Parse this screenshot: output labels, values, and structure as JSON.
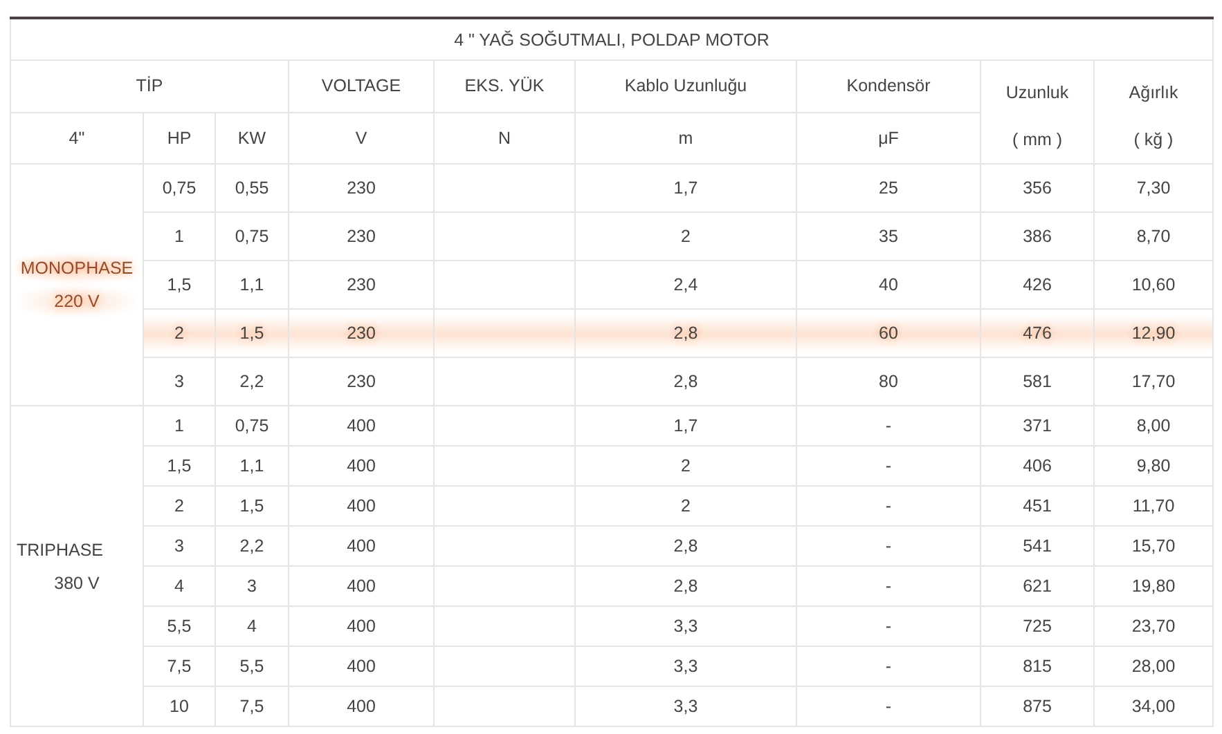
{
  "table": {
    "title": "4 \" YAĞ SOĞUTMALI, POLDAP MOTOR",
    "header_top": [
      {
        "label": "TİP"
      },
      {
        "label": "VOLTAGE"
      },
      {
        "label": "EKS. YÜK"
      },
      {
        "label": "Kablo Uzunluğu"
      },
      {
        "label": "Kondensör"
      }
    ],
    "header_units": [
      "4\"",
      "HP",
      "KW",
      "V",
      "N",
      "m",
      "μF"
    ],
    "header_tall": [
      {
        "label": "Uzunluk",
        "unit": "( mm )"
      },
      {
        "label": "Ağırlık",
        "unit": "( kğ )"
      }
    ],
    "groups": [
      {
        "label_lines": [
          "MONOPHASE",
          "220 V"
        ],
        "highlighted": true,
        "rows": [
          {
            "hp": "0,75",
            "kw": "0,55",
            "voltage": "230",
            "kablo": "1,7",
            "kondensor": "25",
            "uzunluk": "356",
            "agirlik": "7,30",
            "highlighted": false
          },
          {
            "hp": "1",
            "kw": "0,75",
            "voltage": "230",
            "kablo": "2",
            "kondensor": "35",
            "uzunluk": "386",
            "agirlik": "8,70",
            "highlighted": false
          },
          {
            "hp": "1,5",
            "kw": "1,1",
            "voltage": "230",
            "kablo": "2,4",
            "kondensor": "40",
            "uzunluk": "426",
            "agirlik": "10,60",
            "highlighted": false
          },
          {
            "hp": "2",
            "kw": "1,5",
            "voltage": "230",
            "kablo": "2,8",
            "kondensor": "60",
            "uzunluk": "476",
            "agirlik": "12,90",
            "highlighted": true
          },
          {
            "hp": "3",
            "kw": "2,2",
            "voltage": "230",
            "kablo": "2,8",
            "kondensor": "80",
            "uzunluk": "581",
            "agirlik": "17,70",
            "highlighted": false
          }
        ]
      },
      {
        "label_lines": [
          "TRIPHASE",
          "380 V"
        ],
        "highlighted": false,
        "rows": [
          {
            "hp": "1",
            "kw": "0,75",
            "voltage": "400",
            "kablo": "1,7",
            "kondensor": "-",
            "uzunluk": "371",
            "agirlik": "8,00",
            "highlighted": false
          },
          {
            "hp": "1,5",
            "kw": "1,1",
            "voltage": "400",
            "kablo": "2",
            "kondensor": "-",
            "uzunluk": "406",
            "agirlik": "9,80",
            "highlighted": false
          },
          {
            "hp": "2",
            "kw": "1,5",
            "voltage": "400",
            "kablo": "2",
            "kondensor": "-",
            "uzunluk": "451",
            "agirlik": "11,70",
            "highlighted": false
          },
          {
            "hp": "3",
            "kw": "2,2",
            "voltage": "400",
            "kablo": "2,8",
            "kondensor": "-",
            "uzunluk": "541",
            "agirlik": "15,70",
            "highlighted": false
          },
          {
            "hp": "4",
            "kw": "3",
            "voltage": "400",
            "kablo": "2,8",
            "kondensor": "-",
            "uzunluk": "621",
            "agirlik": "19,80",
            "highlighted": false
          },
          {
            "hp": "5,5",
            "kw": "4",
            "voltage": "400",
            "kablo": "3,3",
            "kondensor": "-",
            "uzunluk": "725",
            "agirlik": "23,70",
            "highlighted": false
          },
          {
            "hp": "7,5",
            "kw": "5,5",
            "voltage": "400",
            "kablo": "3,3",
            "kondensor": "-",
            "uzunluk": "815",
            "agirlik": "28,00",
            "highlighted": false
          },
          {
            "hp": "10",
            "kw": "7,5",
            "voltage": "400",
            "kablo": "3,3",
            "kondensor": "-",
            "uzunluk": "875",
            "agirlik": "34,00",
            "highlighted": false
          }
        ]
      }
    ]
  }
}
